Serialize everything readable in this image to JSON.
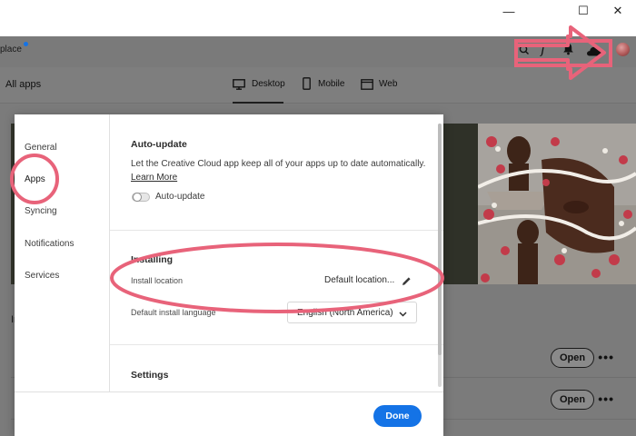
{
  "window": {
    "minimize_glyph": "—",
    "maximize_glyph": "☐",
    "close_glyph": "✕"
  },
  "topbar": {
    "marketplace_partial": "place",
    "icons": [
      "search-icon",
      "fonts-icon",
      "bell-icon",
      "cloud-icon",
      "avatar"
    ]
  },
  "tabbar": {
    "heading": "All apps",
    "tabs": [
      {
        "label": "Desktop",
        "icon": "desktop-icon",
        "active": true
      },
      {
        "label": "Mobile",
        "icon": "mobile-icon",
        "active": false
      },
      {
        "label": "Web",
        "icon": "web-icon",
        "active": false
      }
    ]
  },
  "background": {
    "section_initial": "In",
    "list_rows": [
      {
        "button_label": "Open",
        "more_label": "•••"
      },
      {
        "button_label": "Open",
        "more_label": "•••"
      }
    ]
  },
  "dialog": {
    "sidebar": {
      "items": [
        "General",
        "Apps",
        "Syncing",
        "Notifications",
        "Services"
      ],
      "active_item": "Apps"
    },
    "auto_update": {
      "title": "Auto-update",
      "description": "Let the Creative Cloud app keep all of your apps up to date automatically.",
      "learn_more": "Learn More",
      "toggle_label": "Auto-update",
      "toggle_on": false
    },
    "installing": {
      "title": "Installing",
      "install_location_label": "Install location",
      "install_location_value": "Default location...",
      "language_label": "Default install language",
      "language_value": "English (North America)"
    },
    "settings": {
      "title": "Settings"
    },
    "done_label": "Done"
  },
  "colors": {
    "accent": "#1473e6",
    "annotation": "#e8637a",
    "dim_overlay": "#7b7b7b"
  }
}
